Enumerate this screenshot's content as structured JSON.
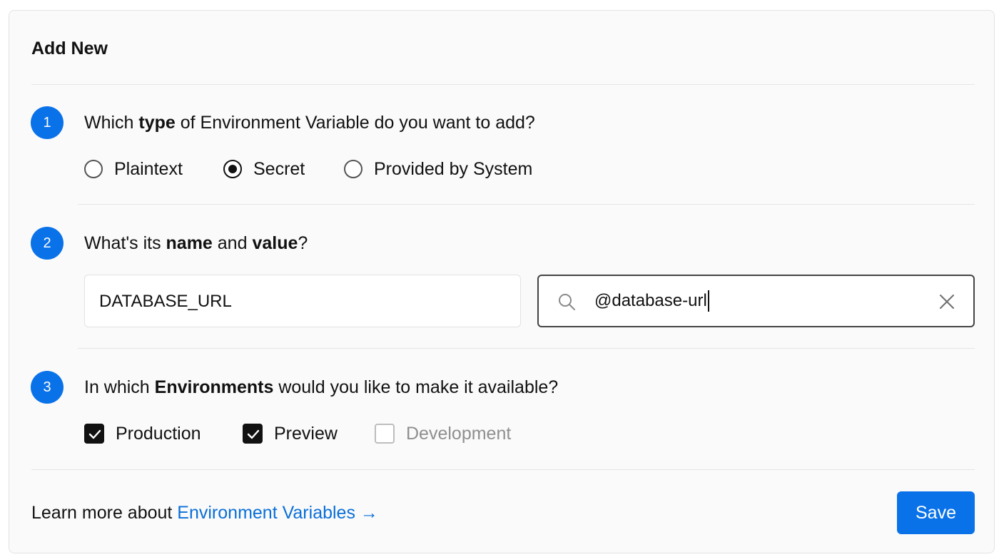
{
  "card": {
    "title": "Add New"
  },
  "step1": {
    "number": "1",
    "question_pre": "Which ",
    "question_bold": "type",
    "question_post": " of Environment Variable do you want to add?",
    "options": [
      {
        "label": "Plaintext",
        "checked": false
      },
      {
        "label": "Secret",
        "checked": true
      },
      {
        "label": "Provided by System",
        "checked": false
      }
    ]
  },
  "step2": {
    "number": "2",
    "question_pre": "What's its ",
    "question_bold1": "name",
    "question_mid": " and ",
    "question_bold2": "value",
    "question_post": "?",
    "name_value": "DATABASE_URL",
    "value_value": "@database-url",
    "search_icon": "search-icon",
    "clear_icon": "close-icon"
  },
  "step3": {
    "number": "3",
    "question_pre": "In which ",
    "question_bold": "Environments",
    "question_post": " would you like to make it available?",
    "options": [
      {
        "label": "Production",
        "checked": true
      },
      {
        "label": "Preview",
        "checked": true
      },
      {
        "label": "Development",
        "checked": false
      }
    ]
  },
  "footer": {
    "text": "Learn more about ",
    "link_text": "Environment Variables",
    "link_arrow": "→",
    "save_label": "Save"
  },
  "colors": {
    "accent": "#0a72e8",
    "link": "#0a6fd8",
    "muted_text": "#8f8f8f"
  }
}
